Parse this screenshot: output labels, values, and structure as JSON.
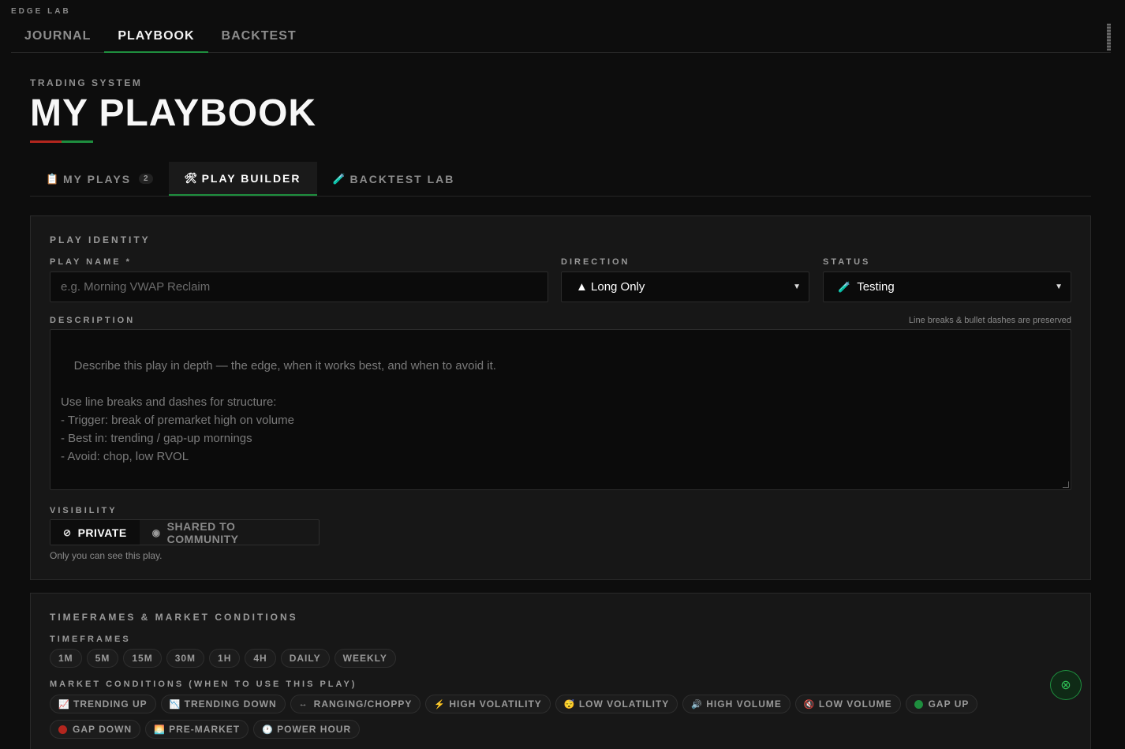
{
  "app": {
    "brand": "EDGE LAB"
  },
  "topnav": {
    "tabs": [
      "JOURNAL",
      "PLAYBOOK",
      "BACKTEST"
    ],
    "active": "PLAYBOOK"
  },
  "header": {
    "eyebrow": "TRADING SYSTEM",
    "title": "MY PLAYBOOK"
  },
  "subtabs": [
    {
      "label": "MY PLAYS",
      "icon": "clipboard-icon",
      "count": "2"
    },
    {
      "label": "PLAY BUILDER",
      "icon": "tools-icon"
    },
    {
      "label": "BACKTEST LAB",
      "icon": "test-tube-icon"
    }
  ],
  "identity": {
    "section_title": "PLAY IDENTITY",
    "name_label": "PLAY NAME *",
    "name_placeholder": "e.g. Morning VWAP Reclaim",
    "direction_label": "DIRECTION",
    "direction_value": "▲ Long Only",
    "status_label": "STATUS",
    "status_value": "Testing",
    "description_label": "DESCRIPTION",
    "description_hint": "Line breaks & bullet dashes are preserved",
    "description_placeholder": "Describe this play in depth — the edge, when it works best, and when to avoid it.\n\nUse line breaks and dashes for structure:\n- Trigger: break of premarket high on volume\n- Best in: trending / gap-up mornings\n- Avoid: chop, low RVOL",
    "visibility_label": "VISIBILITY",
    "visibility_private": "PRIVATE",
    "visibility_shared": "SHARED TO COMMUNITY",
    "visibility_note": "Only you can see this play."
  },
  "conditions": {
    "section_title": "TIMEFRAMES & MARKET CONDITIONS",
    "timeframes_label": "TIMEFRAMES",
    "timeframes": [
      "1M",
      "5M",
      "15M",
      "30M",
      "1H",
      "4H",
      "DAILY",
      "WEEKLY"
    ],
    "market_label": "MARKET CONDITIONS (WHEN TO USE THIS PLAY)",
    "market": [
      {
        "label": "TRENDING UP",
        "icon": "chart-up-icon"
      },
      {
        "label": "TRENDING DOWN",
        "icon": "chart-down-icon"
      },
      {
        "label": "RANGING/CHOPPY",
        "icon": "horizontal-arrows-icon"
      },
      {
        "label": "HIGH VOLATILITY",
        "icon": "lightning-icon"
      },
      {
        "label": "LOW VOLATILITY",
        "icon": "sleepy-face-icon"
      },
      {
        "label": "HIGH VOLUME",
        "icon": "speaker-loud-icon"
      },
      {
        "label": "LOW VOLUME",
        "icon": "speaker-muted-icon"
      },
      {
        "label": "GAP UP",
        "icon": "green-circle-icon"
      },
      {
        "label": "GAP DOWN",
        "icon": "red-circle-icon"
      },
      {
        "label": "PRE-MARKET",
        "icon": "sunrise-icon"
      },
      {
        "label": "POWER HOUR",
        "icon": "clock-icon"
      }
    ]
  },
  "colors": {
    "accent_green": "#1e8e3e",
    "accent_red": "#b3261e"
  }
}
